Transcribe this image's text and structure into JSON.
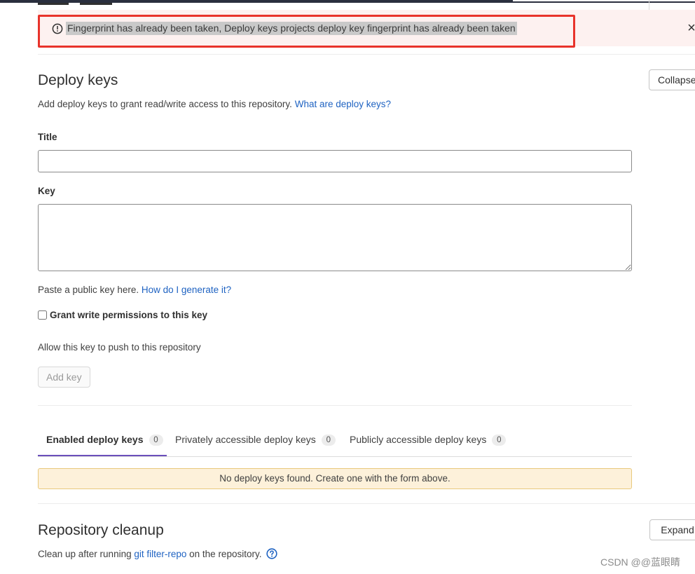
{
  "alert": {
    "message": "Fingerprint has already been taken, Deploy keys projects deploy key fingerprint has already been taken",
    "close_glyph": "×"
  },
  "deploy_keys": {
    "title": "Deploy keys",
    "description": "Add deploy keys to grant read/write access to this repository.",
    "help_link": "What are deploy keys?",
    "collapse_label": "Collapse",
    "form": {
      "title_label": "Title",
      "title_value": "",
      "key_label": "Key",
      "key_value": "",
      "key_hint": "Paste a public key here.",
      "key_hint_link": "How do I generate it?",
      "write_permission_label": "Grant write permissions to this key",
      "write_permission_checked": false,
      "write_permission_help": "Allow this key to push to this repository",
      "submit_label": "Add key"
    },
    "tabs": [
      {
        "label": "Enabled deploy keys",
        "count": "0",
        "active": true
      },
      {
        "label": "Privately accessible deploy keys",
        "count": "0",
        "active": false
      },
      {
        "label": "Publicly accessible deploy keys",
        "count": "0",
        "active": false
      }
    ],
    "empty_message": "No deploy keys found. Create one with the form above."
  },
  "repository_cleanup": {
    "title": "Repository cleanup",
    "description_prefix": "Clean up after running",
    "description_link": "git filter-repo",
    "description_suffix": "on the repository.",
    "expand_label": "Expand"
  },
  "watermark": "CSDN @@蓝眼睛",
  "colors": {
    "alert_bg": "#fdf1f0",
    "highlight_border": "#e8332b",
    "link": "#1f63c2",
    "active_tab": "#6b4fbb",
    "empty_bg": "#fdf1da"
  },
  "icons": {
    "alert": "error-circle-icon",
    "close": "close-icon",
    "help": "question-circle-icon"
  }
}
